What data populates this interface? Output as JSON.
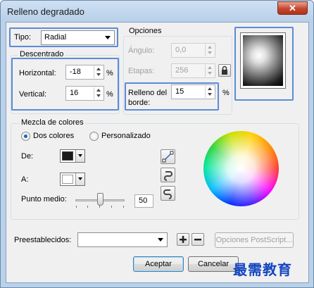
{
  "window": {
    "title": "Relleno degradado",
    "close_glyph": "✕"
  },
  "type": {
    "label": "Tipo:",
    "value": "Radial"
  },
  "options": {
    "legend": "Opciones",
    "angle_label": "Ángulo:",
    "angle_value": "0,0",
    "steps_label": "Etapas:",
    "steps_value": "256",
    "edge_pad_label": "Relleno del borde:",
    "edge_pad_value": "15",
    "edge_pad_unit": "%"
  },
  "offset": {
    "legend": "Descentrado",
    "horizontal_label": "Horizontal:",
    "horizontal_value": "-18",
    "horizontal_unit": "%",
    "vertical_label": "Vertical:",
    "vertical_value": "16",
    "vertical_unit": "%"
  },
  "blend": {
    "legend": "Mezcla de colores",
    "two_colors_label": "Dos colores",
    "custom_label": "Personalizado",
    "from_label": "De:",
    "from_color": "#1a1a1a",
    "to_label": "A:",
    "to_color": "#ffffff",
    "midpoint_label": "Punto medio:",
    "midpoint_value": "50"
  },
  "presets": {
    "label": "Preestablecidos:",
    "value": "",
    "postscript_label": "Opciones PostScript..."
  },
  "buttons": {
    "accept": "Aceptar",
    "cancel": "Cancelar"
  },
  "watermark": "最需教育"
}
